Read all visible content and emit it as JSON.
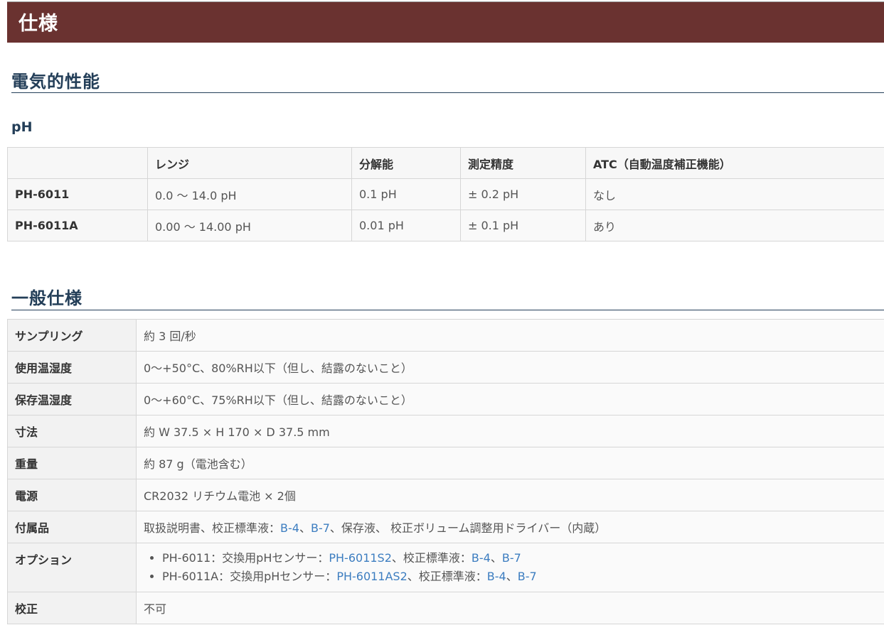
{
  "header": {
    "title": "仕様"
  },
  "electrical": {
    "heading": "電気的性能",
    "subheading": "pH",
    "columns": [
      "",
      "レンジ",
      "分解能",
      "測定精度",
      "ATC（自動温度補正機能）"
    ],
    "rows": [
      [
        "PH-6011",
        "0.0 〜 14.0 pH",
        "0.1 pH",
        "± 0.2 pH",
        "なし"
      ],
      [
        "PH-6011A",
        "0.00 〜 14.00 pH",
        "0.01 pH",
        "± 0.1 pH",
        "あり"
      ]
    ]
  },
  "general": {
    "heading": "一般仕様",
    "sampling": {
      "label": "サンプリング",
      "value": "約 3 回/秒"
    },
    "op_temp": {
      "label": "使用温湿度",
      "value": "0〜+50°C、80%RH以下（但し、結露のないこと）"
    },
    "storage_temp": {
      "label": "保存温湿度",
      "value": "0〜+60°C、75%RH以下（但し、結露のないこと）"
    },
    "dimensions": {
      "label": "寸法",
      "value": "約 W 37.5 × H 170 × D 37.5 mm"
    },
    "weight": {
      "label": "重量",
      "value": "約 87 g（電池含む）"
    },
    "power": {
      "label": "電源",
      "value": "CR2032 リチウム電池 × 2個"
    },
    "accessories": {
      "label": "付属品",
      "text1": "取扱説明書、校正標準液：",
      "link1": "B-4",
      "sep1": "、",
      "link2": "B-7",
      "text2": "、保存液、 校正ボリューム調整用ドライバー（内蔵）"
    },
    "options": {
      "label": "オプション",
      "items": [
        {
          "prefix": "PH-6011：交換用pHセンサー：",
          "sensor": "PH-6011S2",
          "mid": "、校正標準液：",
          "l1": "B-4",
          "sep": "、",
          "l2": "B-7"
        },
        {
          "prefix": "PH-6011A：交換用pHセンサー：",
          "sensor": "PH-6011AS2",
          "mid": "、校正標準液：",
          "l1": "B-4",
          "sep": "、",
          "l2": "B-7"
        }
      ]
    },
    "calibration": {
      "label": "校正",
      "value": "不可"
    }
  },
  "colors": {
    "header_bg": "#6a3230",
    "heading": "#233e58",
    "link": "#3c7dc0"
  }
}
